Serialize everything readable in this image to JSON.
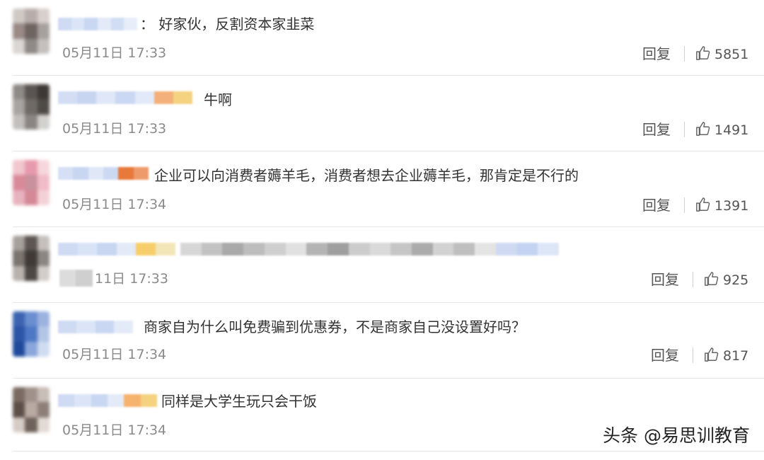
{
  "comments": [
    {
      "text": "：  好家伙，反割资本家韭菜",
      "time": "05月11日 17:33",
      "reply": "回复",
      "likes": "5851",
      "avatar_colors": [
        "#cfc9c6",
        "#b8aca8",
        "#d7d0cd",
        "#9a8a86",
        "#6e6460",
        "#a7a19d",
        "#dad6d3",
        "#8f8a87",
        "#c4c0be"
      ],
      "name_colors": [
        "#cfdaf3",
        "#dbe5f7",
        "#c9d7f2",
        "#e3eaf8",
        "#d1ddf4",
        "#e8eef9"
      ]
    },
    {
      "text": "牛啊",
      "time": "05月11日 17:33",
      "reply": "回复",
      "likes": "1491",
      "avatar_colors": [
        "#8e8a88",
        "#5a5552",
        "#3d3835",
        "#a8a4a1",
        "#6f6a67",
        "#4e4a47",
        "#c2bfbd",
        "#8a8582",
        "#d3d1cf"
      ],
      "name_colors": [
        "#d3def5",
        "#c7d5f1",
        "#dfe7f8",
        "#cbd8f3",
        "#e2e9f8",
        "#f3b07a",
        "#f5d27f"
      ]
    },
    {
      "text": "企业可以向消费者薅羊毛，消费者想去企业薅羊毛，那肯定是不行的",
      "time": "05月11日 17:34",
      "reply": "回复",
      "likes": "1391",
      "avatar_colors": [
        "#f1c6cf",
        "#e79aab",
        "#f6d7dd",
        "#d98a9a",
        "#c9909d",
        "#f0bcc7",
        "#e7b3bf",
        "#d58896",
        "#f4d1d8"
      ],
      "name_colors": [
        "#d6e0f5",
        "#c8d6f2",
        "#e0e8f8",
        "#cdd9f3",
        "#e7793b",
        "#ef9a6a"
      ]
    },
    {
      "text": "",
      "time": "11日 17:33",
      "reply": "回复",
      "likes": "925",
      "avatar_colors": [
        "#a6a19d",
        "#5d5651",
        "#c5c0bc",
        "#7a736e",
        "#3f3a36",
        "#8c8682",
        "#b8b2ae",
        "#4e4844",
        "#d2cdca"
      ],
      "name_colors": [
        "#cfdaf3",
        "#d9e3f6",
        "#c8d6f2",
        "#e3eaf8",
        "#f6cf6a",
        "#f2e6b8"
      ]
    },
    {
      "text": "商家自为什么叫免费骗到优惠券，不是商家自己没设置好吗？",
      "time": "05月11日 17:34",
      "reply": "回复",
      "likes": "817",
      "avatar_colors": [
        "#3c64b0",
        "#6b8ed0",
        "#9bb2de",
        "#2d55a5",
        "#4f78c4",
        "#b4c6e6",
        "#1f4a9b",
        "#8aa6da",
        "#d0dcf0"
      ],
      "name_colors": [
        "#cfdaf3",
        "#dbe5f7",
        "#c9d7f2",
        "#e3eaf8"
      ]
    },
    {
      "text": "同样是大学生玩只会干饭",
      "time": "05月11日 17:34",
      "reply": "回复",
      "likes": "",
      "avatar_colors": [
        "#7a6a62",
        "#a0928b",
        "#c8bdb7",
        "#5d4f48",
        "#b9aaa2",
        "#8d7f78",
        "#d6ccc6",
        "#6f625b",
        "#e2dad6"
      ],
      "name_colors": [
        "#cfdaf3",
        "#dbe5f7",
        "#c9d7f2",
        "#e3eaf8",
        "#f6b36e",
        "#f5d27f"
      ]
    }
  ],
  "blurred_row4_colors": [
    "#d7d7d7",
    "#c2c2c2",
    "#a9a9a9",
    "#bdbdbd",
    "#cfcfcf",
    "#e1e1e1",
    "#b4b4b4",
    "#9f9f9f",
    "#cccccc",
    "#dadada",
    "#c6c6c6",
    "#ababab",
    "#d2d2d2",
    "#bfbfbf",
    "#e4e4e4",
    "#cfd9f2",
    "#c4d3f1",
    "#dde6f7"
  ],
  "watermark": "头条 @易思训教育",
  "colors": {
    "text": "#333333",
    "meta": "#8a8a8a",
    "divider": "#e6e6e6"
  }
}
